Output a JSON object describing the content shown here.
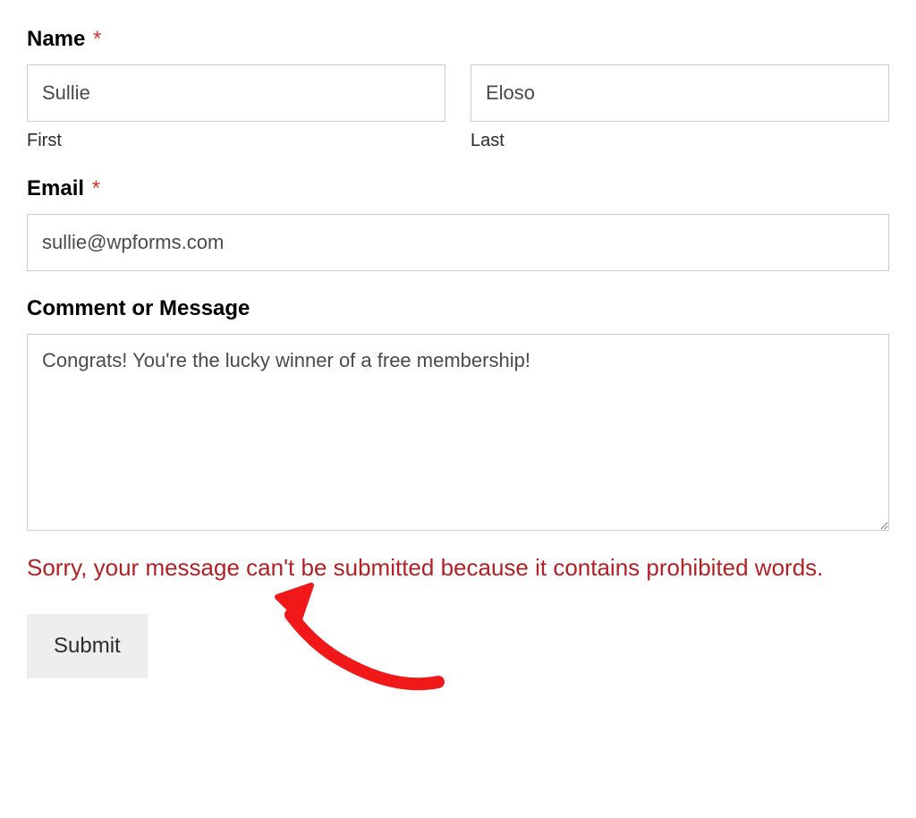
{
  "form": {
    "name": {
      "label": "Name",
      "required": true,
      "first_label": "First",
      "last_label": "Last",
      "first_value": "Sullie",
      "last_value": "Eloso"
    },
    "email": {
      "label": "Email",
      "required": true,
      "value": "sullie@wpforms.com"
    },
    "message": {
      "label": "Comment or Message",
      "required": false,
      "value": "Congrats! You're the lucky winner of a free membership!"
    },
    "error": "Sorry, your message can't be submitted because it contains prohibited words.",
    "submit_label": "Submit"
  }
}
